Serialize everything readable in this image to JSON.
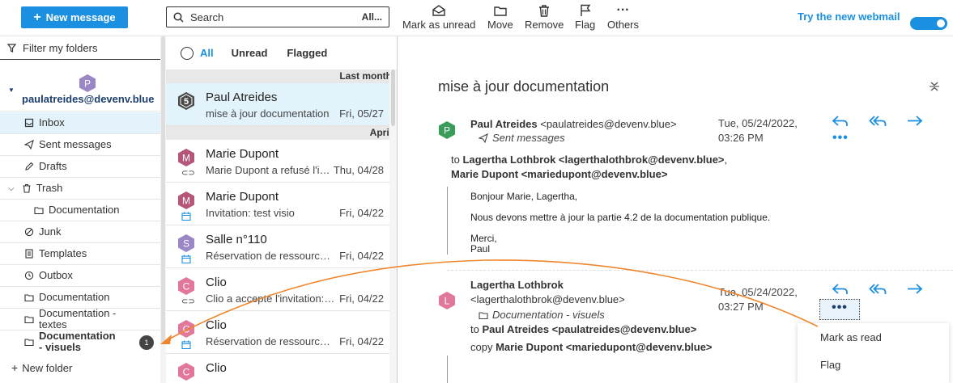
{
  "toolbar": {
    "new_message": "New message",
    "search_placeholder": "Search",
    "search_scope": "All...",
    "mark_unread": "Mark as unread",
    "move": "Move",
    "remove": "Remove",
    "flag": "Flag",
    "others": "Others",
    "try_webmail": "Try the new webmail",
    "accent": "#1b8fe0"
  },
  "sidebar": {
    "filter": "Filter my folders",
    "account_initial": "P",
    "account": "paulatreides@devenv.blue",
    "folders": [
      {
        "label": "Inbox",
        "icon": "inbox-icon"
      },
      {
        "label": "Sent messages",
        "icon": "send-icon"
      },
      {
        "label": "Drafts",
        "icon": "pencil-icon"
      },
      {
        "label": "Trash",
        "icon": "trash-icon"
      },
      {
        "label": "Documentation",
        "icon": "folder-icon"
      },
      {
        "label": "Junk",
        "icon": "block-icon"
      },
      {
        "label": "Templates",
        "icon": "template-icon"
      },
      {
        "label": "Outbox",
        "icon": "clock-icon"
      },
      {
        "label": "Documentation",
        "icon": "folder-icon"
      },
      {
        "label": "Documentation - textes",
        "icon": "folder-icon"
      },
      {
        "label": "Documentation - visuels",
        "icon": "folder-icon",
        "badge": "1"
      }
    ],
    "new_folder": "New folder"
  },
  "list": {
    "tabs": [
      "All",
      "Unread",
      "Flagged"
    ],
    "group_last_month": "Last month",
    "group_april": "April",
    "messages": [
      {
        "initial": "5",
        "from": "Paul Atreides",
        "preview": "mise à jour documentation",
        "date": "Fri, 05/27"
      },
      {
        "initial": "M",
        "from": "Marie Dupont",
        "preview": "Marie Dupont a refusé l'invitation",
        "date": "Thu, 04/28"
      },
      {
        "initial": "M",
        "from": "Marie Dupont",
        "preview": "Invitation: test visio",
        "date": "Fri, 04/22"
      },
      {
        "initial": "S",
        "from": "Salle n°110",
        "preview": "Réservation de ressource: Salle",
        "date": "Fri, 04/22"
      },
      {
        "initial": "C",
        "from": "Clio",
        "preview": "Clio a accepté l'invitation: test",
        "date": "Fri, 04/22"
      },
      {
        "initial": "C",
        "from": "Clio",
        "preview": "Réservation de ressource: Salle",
        "date": "Fri, 04/22"
      },
      {
        "initial": "C",
        "from": "Clio",
        "preview": "",
        "date": ""
      }
    ]
  },
  "reader": {
    "subject": "mise à jour documentation",
    "msg1": {
      "initial": "P",
      "from_name": "Paul Atreides",
      "from_email": "<paulatreides@devenv.blue>",
      "folder": "Sent messages",
      "date_line1": "Tue, 05/24/2022,",
      "date_line2": "03:26 PM",
      "to_label": "to",
      "to_line1": "Lagertha Lothbrok <lagerthalothbrok@devenv.blue>",
      "to_comma": ",",
      "to_line2": "Marie Dupont <mariedupont@devenv.blue>",
      "body1": "Bonjour Marie, Lagertha,",
      "body2": "Nous devons mettre à jour la partie 4.2 de la documentation publique.",
      "body3": "Merci,",
      "body4": "Paul"
    },
    "msg2": {
      "initial": "L",
      "from_name": "Lagertha Lothbrok",
      "from_email": "<lagerthalothbrok@devenv.blue>",
      "folder": "Documentation - visuels",
      "date_line1": "Tue, 05/24/2022,",
      "date_line2": "03:27 PM",
      "to_label": "to",
      "to": "Paul Atreides <paulatreides@devenv.blue>",
      "copy_label": "copy",
      "copy": "Marie Dupont <mariedupont@devenv.blue>"
    },
    "menu": [
      "Mark as read",
      "Flag"
    ]
  }
}
